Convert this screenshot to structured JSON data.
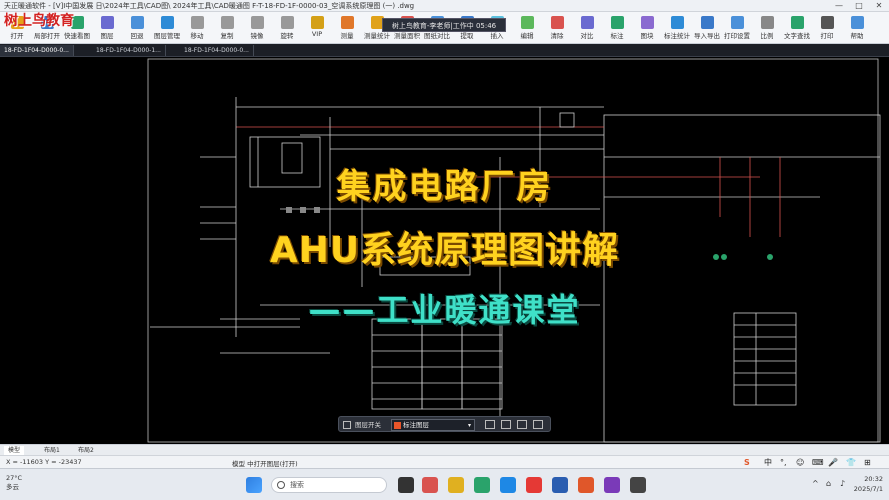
{
  "window": {
    "title": "天正暖通软件 - [V]I中国发展 日\\2024年工具\\CAD图\\ 2024年工具\\CAD暖通图 F-T-18-FD-1F-0000-03_空调系统原理图 (一) .dwg"
  },
  "logo_text": "树上鸟教育",
  "toolbar": {
    "items": [
      {
        "label": "打开",
        "color": "#e5a21a"
      },
      {
        "label": "局部打开",
        "color": "#3a79c9"
      },
      {
        "label": "快速看图",
        "color": "#2aa36b"
      },
      {
        "label": "图层",
        "color": "#6a6ad0"
      },
      {
        "label": "回退",
        "color": "#4a90d9"
      },
      {
        "label": "图层管理",
        "color": "#2e8bd6"
      },
      {
        "label": "移动",
        "color": "#999999"
      },
      {
        "label": "复制",
        "color": "#999999"
      },
      {
        "label": "镜像",
        "color": "#999999"
      },
      {
        "label": "旋转",
        "color": "#999999"
      },
      {
        "label": "VIP",
        "color": "#d4a017"
      },
      {
        "label": "测量",
        "color": "#e0772a"
      },
      {
        "label": "测量统计",
        "color": "#e0a21a"
      },
      {
        "label": "测量面积",
        "color": "#d9534f"
      },
      {
        "label": "图纸对比",
        "color": "#4a90d9"
      },
      {
        "label": "提取",
        "color": "#3a79c9"
      },
      {
        "label": "插入",
        "color": "#5bc0de"
      },
      {
        "label": "编辑",
        "color": "#5cb85c"
      },
      {
        "label": "清除",
        "color": "#d9534f"
      },
      {
        "label": "对比",
        "color": "#6a6ad0"
      },
      {
        "label": "标注",
        "color": "#2aa36b"
      },
      {
        "label": "图块",
        "color": "#8a6ad0"
      },
      {
        "label": "标注统计",
        "color": "#2e8bd6"
      },
      {
        "label": "导入导出",
        "color": "#3a79c9"
      },
      {
        "label": "打印设置",
        "color": "#4a90d9"
      },
      {
        "label": "比例",
        "color": "#888888"
      },
      {
        "label": "文字查找",
        "color": "#2aa36b"
      },
      {
        "label": "打印",
        "color": "#555555"
      },
      {
        "label": "帮助",
        "color": "#4a90d9"
      }
    ]
  },
  "tabs": {
    "doc": [
      "18-FD-1F04-D000-0...",
      "18-FD-1F04-D000-1...",
      "18-FD-1F04-D000-0..."
    ]
  },
  "overlay": {
    "recording_time": "树上鸟教育-李老师|工作中 05:46"
  },
  "headlines": {
    "line1": "集成电路厂房",
    "line2": "AHU系统原理图讲解",
    "line3": "——工业暖通课堂"
  },
  "float_toolbar": {
    "left_label": "图层开关",
    "layer_select": "标注图层",
    "layer_color": "#e8552a"
  },
  "layout_tabs": [
    "模型",
    "布局1",
    "布局2"
  ],
  "status": {
    "coords": "X = -11603 Y = -23437",
    "mode": "模型 中打开图层(打开)"
  },
  "ime": [
    "S",
    "中",
    "°,",
    "☺",
    "⌨",
    "🎤",
    "👕",
    "⊞"
  ],
  "taskbar": {
    "weather_temp": "27°C",
    "weather_desc": "多云",
    "search_placeholder": "搜索",
    "time": "20:32",
    "date": "2025/7/1"
  }
}
